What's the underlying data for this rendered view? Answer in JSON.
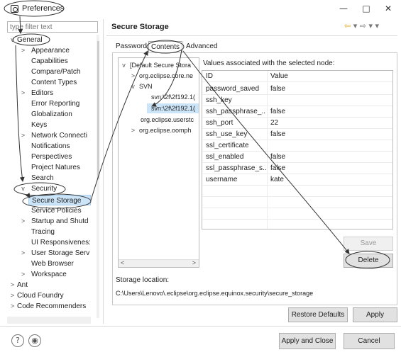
{
  "window": {
    "title": "Preferences",
    "minimize_glyph": "—",
    "maximize_glyph": "□",
    "close_glyph": "✕"
  },
  "filter": {
    "placeholder": "type filter text"
  },
  "tree": {
    "items": [
      {
        "label": "General",
        "twisty": "v"
      },
      {
        "label": "Appearance",
        "twisty": ">"
      },
      {
        "label": "Capabilities",
        "twisty": ""
      },
      {
        "label": "Compare/Patch",
        "twisty": ""
      },
      {
        "label": "Content Types",
        "twisty": ""
      },
      {
        "label": "Editors",
        "twisty": ">"
      },
      {
        "label": "Error Reporting",
        "twisty": ""
      },
      {
        "label": "Globalization",
        "twisty": ""
      },
      {
        "label": "Keys",
        "twisty": ""
      },
      {
        "label": "Network Connecti",
        "twisty": ">"
      },
      {
        "label": "Notifications",
        "twisty": ""
      },
      {
        "label": "Perspectives",
        "twisty": ""
      },
      {
        "label": "Project Natures",
        "twisty": ""
      },
      {
        "label": "Search",
        "twisty": ""
      },
      {
        "label": "Security",
        "twisty": "v"
      },
      {
        "label": "Secure Storage",
        "twisty": ""
      },
      {
        "label": "Service Policies",
        "twisty": ""
      },
      {
        "label": "Startup and Shutd",
        "twisty": ">"
      },
      {
        "label": "Tracing",
        "twisty": ""
      },
      {
        "label": "UI Responsivenes:",
        "twisty": ""
      },
      {
        "label": "User Storage Serv",
        "twisty": ">"
      },
      {
        "label": "Web Browser",
        "twisty": ""
      },
      {
        "label": "Workspace",
        "twisty": ">"
      },
      {
        "label": "Ant",
        "twisty": ">"
      },
      {
        "label": "Cloud Foundry",
        "twisty": ">"
      },
      {
        "label": "Code Recommenders",
        "twisty": ">"
      }
    ]
  },
  "page": {
    "title": "Secure Storage",
    "tabs": [
      "Password",
      "Contents",
      "Advanced"
    ],
    "active_tab": "Contents"
  },
  "nodes": {
    "items": [
      {
        "label": "[Default Secure Stora",
        "twisty": "v"
      },
      {
        "label": "org.eclipse.core.ne",
        "twisty": ">"
      },
      {
        "label": "SVN",
        "twisty": "v"
      },
      {
        "label": "svn:\\2f\\2f192.1(",
        "twisty": ""
      },
      {
        "label": "svn:\\2f\\2f192.1(",
        "twisty": ""
      },
      {
        "label": "org.eclipse.userstc",
        "twisty": ""
      },
      {
        "label": "org.eclipse.oomph",
        "twisty": ">"
      }
    ]
  },
  "values": {
    "label": "Values associated with the selected node:",
    "header": {
      "id": "ID",
      "value": "Value"
    },
    "rows": [
      {
        "id": "password_saved",
        "value": "false"
      },
      {
        "id": "ssh_key",
        "value": ""
      },
      {
        "id": "ssh_passphrase_...",
        "value": "false"
      },
      {
        "id": "ssh_port",
        "value": "22"
      },
      {
        "id": "ssh_use_key",
        "value": "false"
      },
      {
        "id": "ssl_certificate",
        "value": ""
      },
      {
        "id": "ssl_enabled",
        "value": "false"
      },
      {
        "id": "ssl_passphrase_s...",
        "value": "false"
      },
      {
        "id": "username",
        "value": "kate"
      }
    ]
  },
  "buttons": {
    "save": "Save",
    "delete": "Delete",
    "restore_defaults": "Restore Defaults",
    "apply": "Apply",
    "apply_and_close": "Apply and Close",
    "cancel": "Cancel"
  },
  "storage": {
    "label": "Storage location:",
    "path": "C:\\Users\\Lenovo\\.eclipse\\org.eclipse.equinox.security\\secure_storage"
  },
  "colors": {
    "selection": "#cce4f7",
    "nav_arrow": "#e0a520"
  }
}
